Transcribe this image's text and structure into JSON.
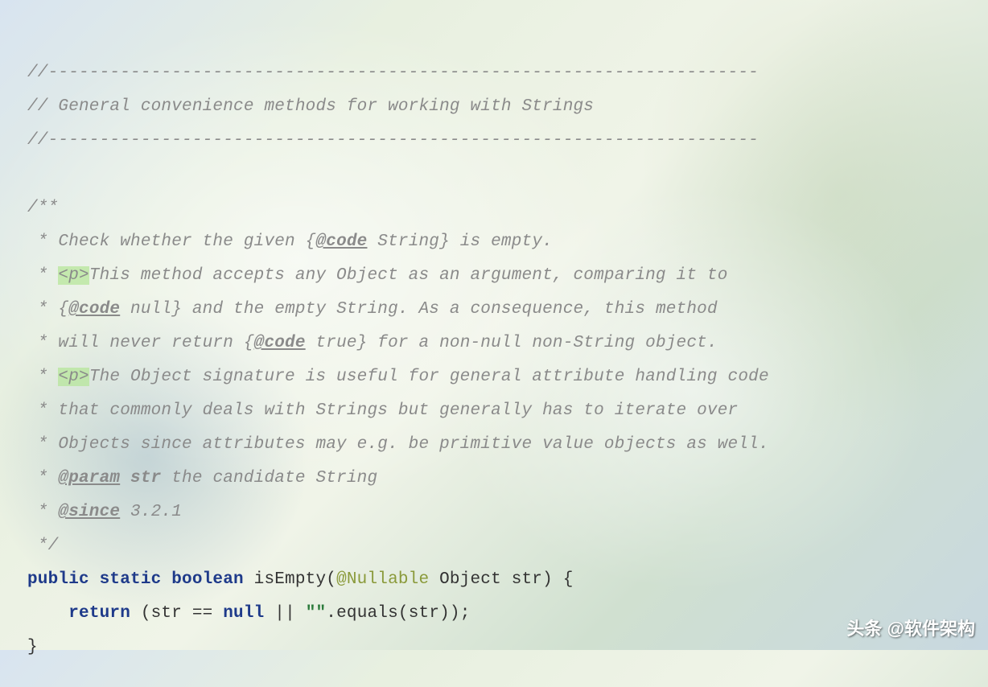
{
  "code": {
    "divider1": "//---------------------------------------------------------------------",
    "header": "// General convenience methods for working with Strings",
    "divider2": "//---------------------------------------------------------------------",
    "doc_open": "/**",
    "doc_l1_a": " * Check whether the given {",
    "doc_l1_tag": "@code",
    "doc_l1_b": " String} is empty.",
    "doc_l2_a": " * ",
    "doc_l2_tag": "<p>",
    "doc_l2_b": "This method accepts any Object as an argument, comparing it to",
    "doc_l3_a": " * {",
    "doc_l3_tag": "@code",
    "doc_l3_b": " null} and the empty String. As a consequence, this method",
    "doc_l4_a": " * will never return {",
    "doc_l4_tag": "@code",
    "doc_l4_b": " true} for a non-null non-String object.",
    "doc_l5_a": " * ",
    "doc_l5_tag": "<p>",
    "doc_l5_b": "The Object signature is useful for general attribute handling code",
    "doc_l6": " * that commonly deals with Strings but generally has to iterate over",
    "doc_l7": " * Objects since attributes may e.g. be primitive value objects as well.",
    "doc_l8_a": " * ",
    "doc_l8_tag": "@param",
    "doc_l8_b": " ",
    "doc_l8_param": "str",
    "doc_l8_c": " the candidate String",
    "doc_l9_a": " * ",
    "doc_l9_tag": "@since",
    "doc_l9_b": " 3.2.1",
    "doc_close": " */",
    "sig_kw1": "public static boolean",
    "sig_a": " isEmpty(",
    "sig_ann": "@Nullable",
    "sig_b": " Object str) {",
    "ret_kw": "return",
    "ret_a": " (str == ",
    "ret_null": "null",
    "ret_b": " || ",
    "ret_str": "\"\"",
    "ret_c": ".equals(str));",
    "close": "}"
  },
  "watermark": "头条 @软件架构"
}
